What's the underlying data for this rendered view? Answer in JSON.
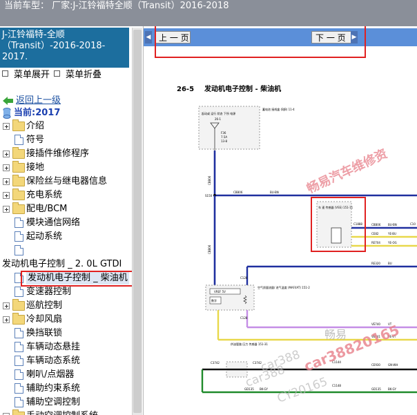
{
  "header": {
    "title": "当前车型：  厂家:J-江铃福特全顺（Transit）2016-2018"
  },
  "sidebar": {
    "head_title": "J-江铃福特-全顺（Transit）-2016-2018- 2017.",
    "expand_label": "菜单展开",
    "collapse_label": "菜单折叠",
    "back_label": "返回上一级",
    "current_label": "当前:2017",
    "items": [
      {
        "label": "介绍",
        "kind": "folder"
      },
      {
        "label": "符号",
        "kind": "doc"
      },
      {
        "label": "接插件维修程序",
        "kind": "folder"
      },
      {
        "label": "接地",
        "kind": "folder"
      },
      {
        "label": "保险丝与继电器信息",
        "kind": "folder"
      },
      {
        "label": "充电系统",
        "kind": "folder"
      },
      {
        "label": "配电/BCM",
        "kind": "folder"
      },
      {
        "label": "模块通信网络",
        "kind": "doc"
      },
      {
        "label": "起动系统",
        "kind": "doc"
      },
      {
        "label": "",
        "kind": "doc"
      },
      {
        "label": "发动机电子控制 _ 2. 0L GTDI",
        "kind": "text"
      },
      {
        "label": "发动机电子控制 _ 柴油机",
        "kind": "doc",
        "selected": true
      },
      {
        "label": "变速器控制",
        "kind": "doc"
      },
      {
        "label": "巡航控制",
        "kind": "folder"
      },
      {
        "label": "冷却风扇",
        "kind": "folder"
      },
      {
        "label": "换挡联锁",
        "kind": "doc"
      },
      {
        "label": "车辆动态悬挂",
        "kind": "doc"
      },
      {
        "label": "车辆动态系统",
        "kind": "doc"
      },
      {
        "label": "喇叭/点烟器",
        "kind": "doc"
      },
      {
        "label": "辅助约束系统",
        "kind": "doc"
      },
      {
        "label": "辅助空调控制",
        "kind": "doc"
      },
      {
        "label": "手动空调控制系统",
        "kind": "folder"
      }
    ]
  },
  "nav": {
    "prev_label": "上 一 页",
    "next_label": "下 一 页"
  },
  "diagram": {
    "section_number": "26-5",
    "section_title": "发动机电子控制 - 柴油机",
    "fusebox_title": "蓄电池\n接线盒\n(BJB)\n11-4",
    "fusebox_modes": "起动或 运行 状态 下所 电源",
    "fuse_ref": "26-1",
    "fuse_id": "F36",
    "fuse_rating": "7.5A",
    "fuse_term": "13-8",
    "vss_title": "车 速 传感器\n(VSS)\n151-11",
    "maf_title": "空气质量流量/\n进气温度\n(MAF/IAT)\n151-2",
    "maf_vref": "VREF 5V",
    "maf_digital": "数字",
    "sensor3_title": "供油管路\n压力\n传感器\n151-31",
    "wires": {
      "cbb06": "CBB06",
      "bu_bn": "BU-BN",
      "s150": "S150",
      "ce82": "CE82",
      "ye_bu": "YE-BU",
      "re704": "RE704",
      "ye_og": "YE-OG",
      "re320": "RE320",
      "bu": "BU",
      "c128": "C128",
      "c1888": "C1888",
      "ve740": "VE740",
      "ve741": "VE741",
      "ye_vt": "YE-VT",
      "vt": "VT",
      "c3742": "C3742",
      "ce930": "CE930",
      "gn_wh": "GN-WH",
      "gd135": "GD135",
      "bk_gy": "BK-GY",
      "c10": "C10",
      "c130": "C130",
      "c1144": "C1144",
      "c1148": "C1148"
    },
    "watermarks": {
      "wm1": "畅易汽车维修资",
      "wm2": "畅易",
      "wm3": "car388",
      "wm4": "car388",
      "wm5": "CY20165",
      "wm6": "car38820165"
    }
  },
  "colors": {
    "title_bar": "#8a8f99",
    "sidebar_head": "#1c6e9e",
    "nav_bar": "#5b8fd9",
    "highlight_box": "#e02020",
    "wire_blue": "#1f2f9f",
    "wire_yellow": "#e8d84a",
    "wire_purple": "#c58ee6",
    "wire_green": "#1f8a2a"
  }
}
